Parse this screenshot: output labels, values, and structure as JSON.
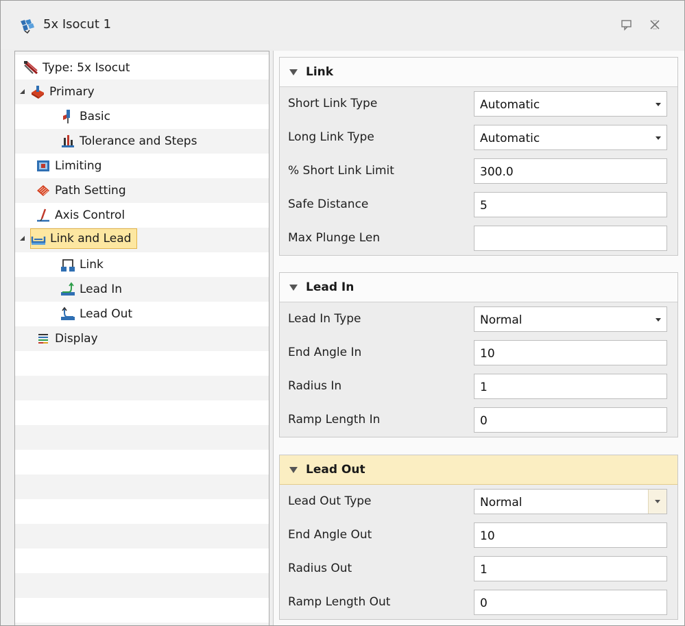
{
  "window": {
    "title": "5x Isocut 1"
  },
  "tree": {
    "items": [
      {
        "label": "Type: 5x Isocut",
        "level": 0,
        "icon": "type-icon"
      },
      {
        "label": "Primary",
        "level": 0,
        "icon": "primary-icon",
        "expanded": true
      },
      {
        "label": "Basic",
        "level": 1,
        "icon": "basic-icon"
      },
      {
        "label": "Tolerance and Steps",
        "level": 1,
        "icon": "tolerance-icon"
      },
      {
        "label": "Limiting",
        "level": 0,
        "icon": "limiting-icon"
      },
      {
        "label": "Path Setting",
        "level": 0,
        "icon": "path-setting-icon"
      },
      {
        "label": "Axis Control",
        "level": 0,
        "icon": "axis-control-icon"
      },
      {
        "label": "Link and Lead",
        "level": 0,
        "icon": "link-lead-icon",
        "expanded": true,
        "selected": true
      },
      {
        "label": "Link",
        "level": 1,
        "icon": "link-icon"
      },
      {
        "label": "Lead In",
        "level": 1,
        "icon": "lead-in-icon"
      },
      {
        "label": "Lead Out",
        "level": 1,
        "icon": "lead-out-icon"
      },
      {
        "label": "Display",
        "level": 0,
        "icon": "display-icon"
      }
    ]
  },
  "sections": {
    "link": {
      "title": "Link",
      "rows": [
        {
          "label": "Short Link Type",
          "value": "Automatic",
          "type": "select"
        },
        {
          "label": "Long Link Type",
          "value": "Automatic",
          "type": "select"
        },
        {
          "label": "% Short Link Limit",
          "value": "300.0",
          "type": "input"
        },
        {
          "label": "Safe Distance",
          "value": "5",
          "type": "input"
        },
        {
          "label": "Max Plunge Len",
          "value": "",
          "type": "input"
        }
      ]
    },
    "lead_in": {
      "title": "Lead In",
      "rows": [
        {
          "label": "Lead In Type",
          "value": "Normal",
          "type": "select"
        },
        {
          "label": "End Angle In",
          "value": "10",
          "type": "input"
        },
        {
          "label": "Radius In",
          "value": "1",
          "type": "input"
        },
        {
          "label": "Ramp Length In",
          "value": "0",
          "type": "input"
        }
      ]
    },
    "lead_out": {
      "title": "Lead Out",
      "rows": [
        {
          "label": "Lead Out Type",
          "value": "Normal",
          "type": "select"
        },
        {
          "label": "End Angle Out",
          "value": "10",
          "type": "input"
        },
        {
          "label": "Radius Out",
          "value": "1",
          "type": "input"
        },
        {
          "label": "Ramp Length Out",
          "value": "0",
          "type": "input"
        }
      ]
    }
  },
  "colors": {
    "selected_bg": "#fde7a1",
    "active_header": "#fbeec2",
    "panel_bg": "#ededed"
  }
}
